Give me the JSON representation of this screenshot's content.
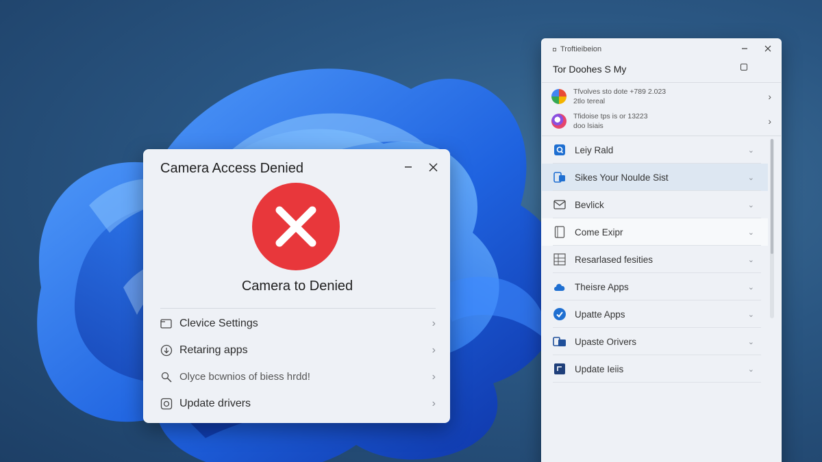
{
  "colors": {
    "accent": "#1f6fd1",
    "error": "#e8373b",
    "panel_bg": "#eef1f6",
    "selected_row": "#dde7f2"
  },
  "dialog": {
    "title": "Camera Access Denied",
    "message": "Camera to Denied",
    "items": [
      {
        "icon": "folder-icon",
        "label": "Clevice Settings"
      },
      {
        "icon": "download-icon",
        "label": "Retaring apps"
      },
      {
        "icon": "search-icon",
        "label": "Olyce bcwnios of biess hrdd!"
      },
      {
        "icon": "camera-icon",
        "label": "Update drivers"
      }
    ]
  },
  "panel": {
    "app_name": "Troftieibeion",
    "header": "Tor  Doohes S My",
    "notifications": [
      {
        "icon": "app-multicolor-icon",
        "line1": "Tfvolves sto dote +789 2.023",
        "line2": "2tlo tereal"
      },
      {
        "icon": "app-pink-icon",
        "line1": "Tfidoise tps is or 13223",
        "line2": "doo lsiais"
      }
    ],
    "items": [
      {
        "icon": "photo-icon",
        "label": "Leiy Rald"
      },
      {
        "icon": "device-icon",
        "label": "Sikes Your Noulde Sist"
      },
      {
        "icon": "mail-icon",
        "label": "Bevlick"
      },
      {
        "icon": "tablet-icon",
        "label": "Come Exipr"
      },
      {
        "icon": "grid-icon",
        "label": "Resarlased fesities"
      },
      {
        "icon": "cloud-icon",
        "label": "Theisre Apps"
      },
      {
        "icon": "check-circle-icon",
        "label": "Upatte Apps"
      },
      {
        "icon": "devices-icon",
        "label": "Upaste Orivers"
      },
      {
        "icon": "update-icon",
        "label": "Update Ieiis"
      }
    ]
  }
}
